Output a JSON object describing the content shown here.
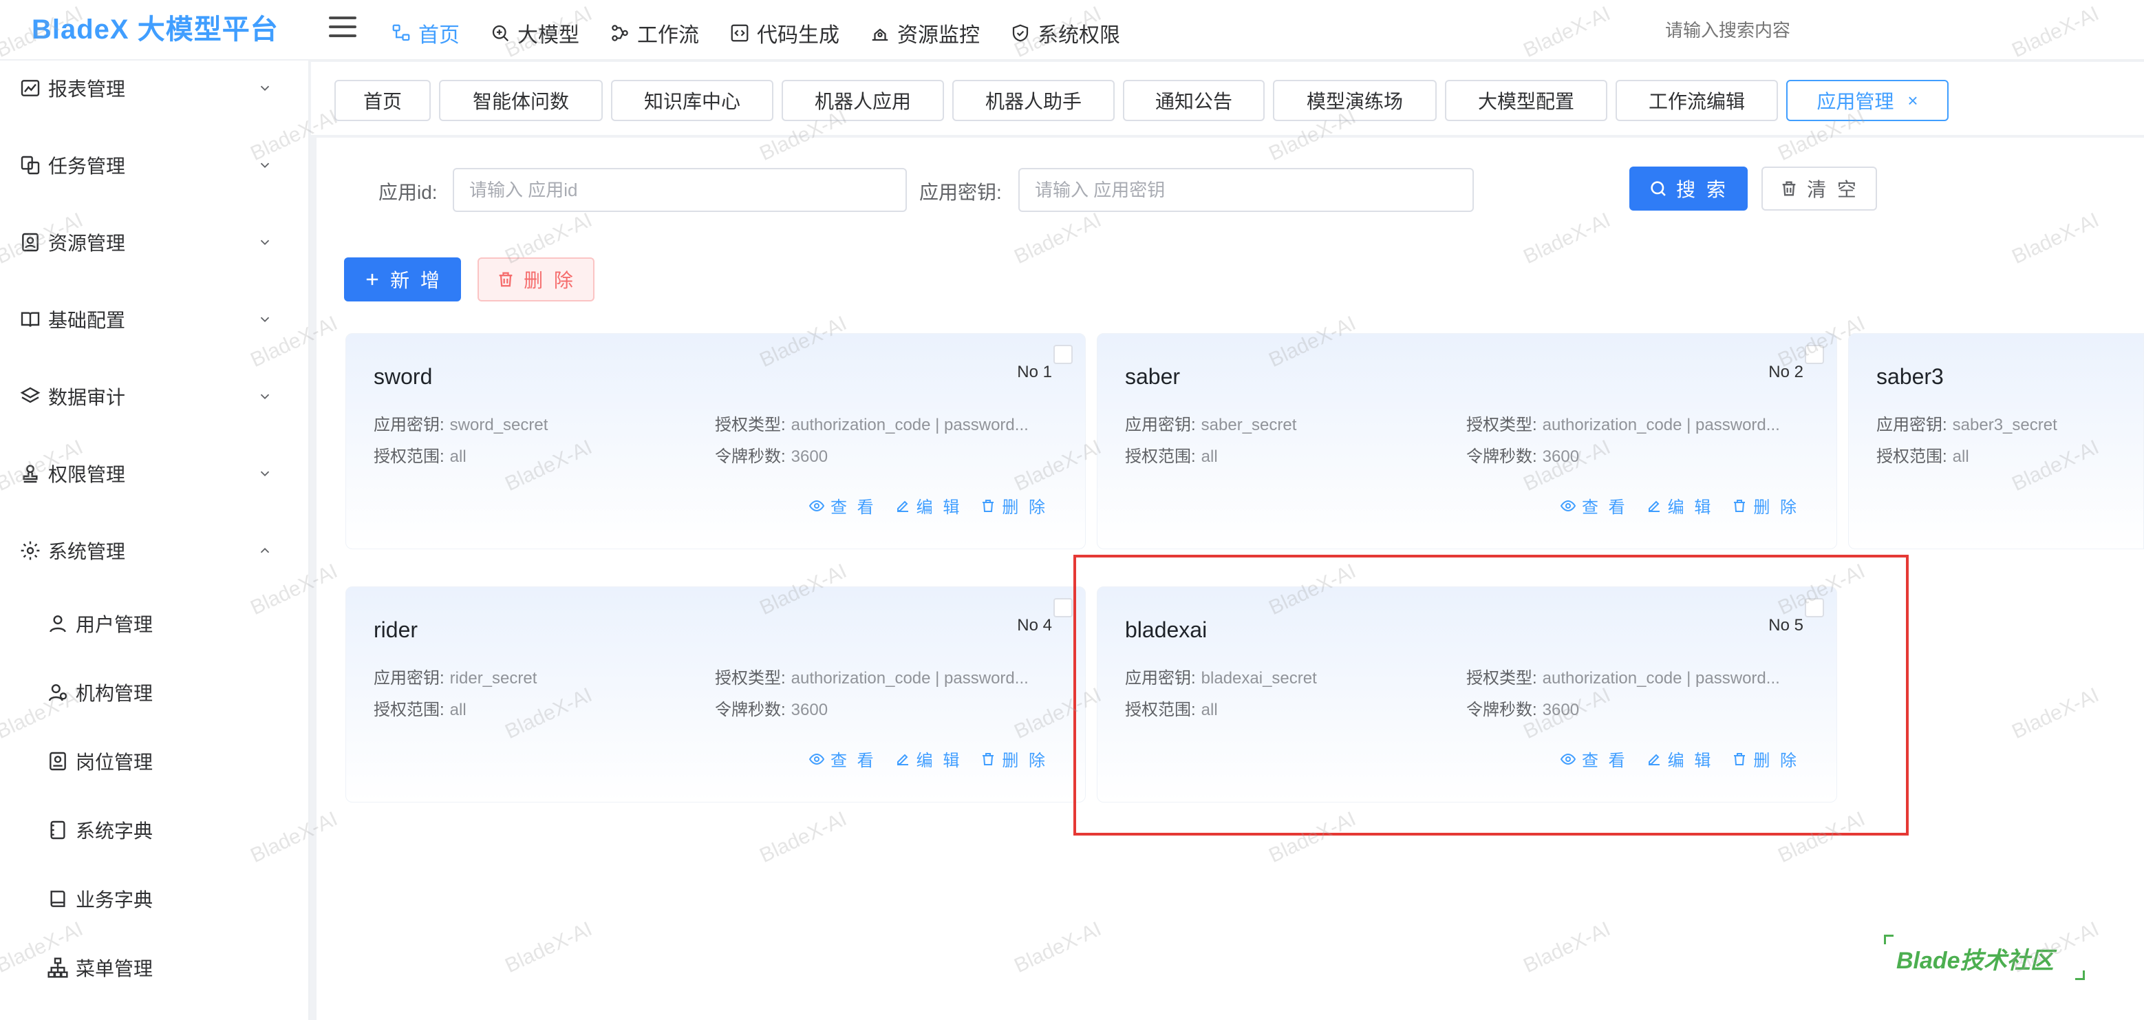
{
  "app": {
    "logo": "BladeX 大模型平台"
  },
  "topnav": [
    {
      "label": "首页",
      "icon": "home-tree-icon",
      "active": true
    },
    {
      "label": "大模型",
      "icon": "ai-brain-icon",
      "active": false
    },
    {
      "label": "工作流",
      "icon": "workflow-icon",
      "active": false
    },
    {
      "label": "代码生成",
      "icon": "code-icon",
      "active": false
    },
    {
      "label": "资源监控",
      "icon": "monitor-icon",
      "active": false
    },
    {
      "label": "系统权限",
      "icon": "shield-icon",
      "active": false
    }
  ],
  "search": {
    "placeholder": "请输入搜索内容"
  },
  "sidebar": {
    "groups": [
      {
        "label": "报表管理",
        "icon": "chart-icon",
        "expanded": false
      },
      {
        "label": "任务管理",
        "icon": "task-icon",
        "expanded": false
      },
      {
        "label": "资源管理",
        "icon": "resource-icon",
        "expanded": false
      },
      {
        "label": "基础配置",
        "icon": "book-icon",
        "expanded": false
      },
      {
        "label": "数据审计",
        "icon": "layers-icon",
        "expanded": false
      },
      {
        "label": "权限管理",
        "icon": "stamp-icon",
        "expanded": false
      },
      {
        "label": "系统管理",
        "icon": "gear-icon",
        "expanded": true
      }
    ],
    "sub_items": [
      {
        "label": "用户管理",
        "icon": "user-icon"
      },
      {
        "label": "机构管理",
        "icon": "org-icon"
      },
      {
        "label": "岗位管理",
        "icon": "badge-icon"
      },
      {
        "label": "系统字典",
        "icon": "dictionary-icon"
      },
      {
        "label": "业务字典",
        "icon": "book-open-icon"
      },
      {
        "label": "菜单管理",
        "icon": "tree-icon"
      }
    ]
  },
  "tags": [
    {
      "label": "首页"
    },
    {
      "label": "智能体问数"
    },
    {
      "label": "知识库中心"
    },
    {
      "label": "机器人应用"
    },
    {
      "label": "机器人助手"
    },
    {
      "label": "通知公告"
    },
    {
      "label": "模型演练场"
    },
    {
      "label": "大模型配置"
    },
    {
      "label": "工作流编辑"
    },
    {
      "label": "应用管理",
      "active": true,
      "close": "×"
    }
  ],
  "filters": {
    "app_id_label": "应用id:",
    "app_id_placeholder": "请输入 应用id",
    "app_secret_label": "应用密钥:",
    "app_secret_placeholder": "请输入 应用密钥",
    "search_button": "搜 索",
    "clear_button": "清 空"
  },
  "toolbar": {
    "add_button": "新 增",
    "delete_button": "删 除"
  },
  "card_labels": {
    "secret": "应用密钥:",
    "grant_type": "授权类型:",
    "scope": "授权范围:",
    "token_seconds": "令牌秒数:",
    "view": "查 看",
    "edit": "编 辑",
    "delete": "删 除"
  },
  "cards": [
    {
      "name": "sword",
      "no": "No 1",
      "secret": "sword_secret",
      "grant_type": "authorization_code | password...",
      "scope": "all",
      "token_seconds": "3600"
    },
    {
      "name": "saber",
      "no": "No 2",
      "secret": "saber_secret",
      "grant_type": "authorization_code | password...",
      "scope": "all",
      "token_seconds": "3600"
    },
    {
      "name": "saber3",
      "no": "",
      "secret": "saber3_secret",
      "grant_type": "",
      "scope": "all",
      "token_seconds": ""
    },
    {
      "name": "rider",
      "no": "No 4",
      "secret": "rider_secret",
      "grant_type": "authorization_code | password...",
      "scope": "all",
      "token_seconds": "3600"
    },
    {
      "name": "bladexai",
      "no": "No 5",
      "secret": "bladexai_secret",
      "grant_type": "authorization_code | password...",
      "scope": "all",
      "token_seconds": "3600"
    }
  ],
  "community": {
    "label": "Blade技术社区"
  },
  "watermark": {
    "text": "BladeX-AI"
  },
  "colors": {
    "primary": "#409eff",
    "danger": "#f56c6c",
    "highlight": "#e53935",
    "community": "#4caf50"
  }
}
